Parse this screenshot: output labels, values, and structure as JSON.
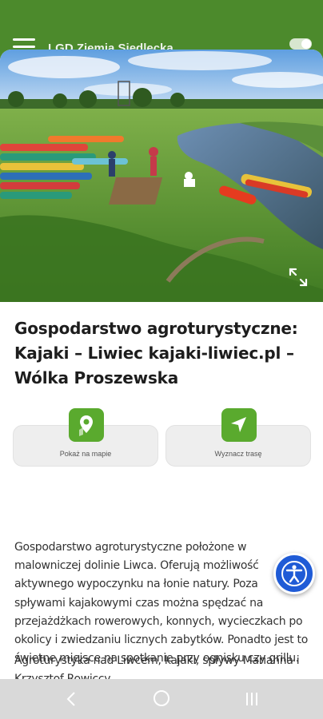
{
  "app_bar": {
    "title": "LGD Ziemia Siedlecka",
    "menu_icon": "hamburger-menu-icon",
    "toggle_icon": "toggle-switch-icon",
    "color": "#4c8a2c"
  },
  "hero": {
    "image": "kayaks-on-river-photo",
    "expand_icon": "fullscreen-expand-icon"
  },
  "place": {
    "title": "Gospodarstwo agroturystyczne: Kajaki – Liwiec kajaki-liwiec.pl – Wólka Proszewska"
  },
  "actions": {
    "map": {
      "label": "Pokaż na mapie",
      "icon": "map-pin-icon"
    },
    "route": {
      "label": "Wyznacz trasę",
      "icon": "navigation-arrow-icon"
    },
    "accent": "#5aaa2e"
  },
  "description": {
    "paragraph1": "Gospodarstwo agroturystyczne położone w malowniczej dolinie Liwca. Oferują możliwość aktywnego wypoczynku na łonie natury. Poza spływami kajakowymi czas można spędzać na przejażdżkach rowerowych, konnych, wycieczkach po okolicy i zwiedzaniu licznych zabytków. Ponadto jest to świetne miejsce na spotkanie przy ognisku czy grillu.",
    "paragraph2": "Agroturystyka nad Liwcem, kajaki, spływy Marianna i Krzysztof Rowiccy"
  },
  "accessibility": {
    "icon": "accessibility-person-icon",
    "color": "#1f5bd6"
  },
  "system_nav": {
    "back_icon": "back-chevron-icon",
    "home_icon": "home-circle-icon",
    "recent_icon": "recent-apps-icon"
  }
}
